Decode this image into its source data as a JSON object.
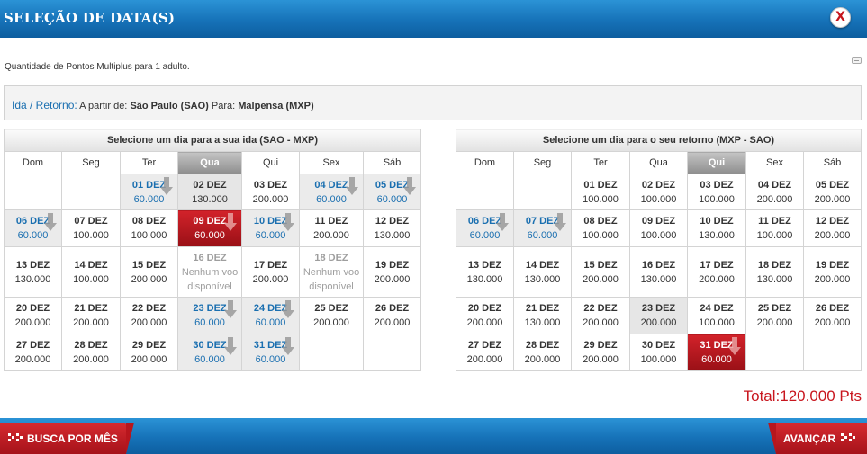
{
  "header": {
    "title": "SELEÇÃO DE DATA(S)",
    "close_label": "X"
  },
  "info": {
    "quantity_text": "Quantidade de Pontos Multiplus para 1 adulto."
  },
  "route": {
    "label": "Ida / Retorno:",
    "from_prefix": "A partir de:",
    "from": "São Paulo (SAO)",
    "to_prefix": "Para:",
    "to": "Malpensa (MXP)"
  },
  "weekdays": [
    "Dom",
    "Seg",
    "Ter",
    "Qua",
    "Qui",
    "Sex",
    "Sáb"
  ],
  "outbound": {
    "title": "Selecione um dia para a sua ida (SAO - MXP)",
    "active_weekday": 3,
    "weeks": [
      [
        null,
        null,
        {
          "day": "01 DEZ",
          "points": "60.000",
          "state": "low"
        },
        {
          "day": "02 DEZ",
          "points": "130.000",
          "state": "grey"
        },
        {
          "day": "03 DEZ",
          "points": "200.000"
        },
        {
          "day": "04 DEZ",
          "points": "60.000",
          "state": "low"
        },
        {
          "day": "05 DEZ",
          "points": "60.000",
          "state": "low"
        }
      ],
      [
        {
          "day": "06 DEZ",
          "points": "60.000",
          "state": "low"
        },
        {
          "day": "07 DEZ",
          "points": "100.000"
        },
        {
          "day": "08 DEZ",
          "points": "100.000"
        },
        {
          "day": "09 DEZ",
          "points": "60.000",
          "state": "selected"
        },
        {
          "day": "10 DEZ",
          "points": "60.000",
          "state": "low"
        },
        {
          "day": "11 DEZ",
          "points": "200.000"
        },
        {
          "day": "12 DEZ",
          "points": "130.000"
        }
      ],
      [
        {
          "day": "13 DEZ",
          "points": "130.000"
        },
        {
          "day": "14 DEZ",
          "points": "100.000"
        },
        {
          "day": "15 DEZ",
          "points": "200.000"
        },
        {
          "day": "16 DEZ",
          "points": "Nenhum voo",
          "extra": "disponível",
          "state": "unavailable"
        },
        {
          "day": "17 DEZ",
          "points": "200.000"
        },
        {
          "day": "18 DEZ",
          "points": "Nenhum voo",
          "extra": "disponível",
          "state": "unavailable"
        },
        {
          "day": "19 DEZ",
          "points": "200.000"
        }
      ],
      [
        {
          "day": "20 DEZ",
          "points": "200.000"
        },
        {
          "day": "21 DEZ",
          "points": "200.000"
        },
        {
          "day": "22 DEZ",
          "points": "200.000"
        },
        {
          "day": "23 DEZ",
          "points": "60.000",
          "state": "low"
        },
        {
          "day": "24 DEZ",
          "points": "60.000",
          "state": "low"
        },
        {
          "day": "25 DEZ",
          "points": "200.000"
        },
        {
          "day": "26 DEZ",
          "points": "200.000"
        }
      ],
      [
        {
          "day": "27 DEZ",
          "points": "200.000"
        },
        {
          "day": "28 DEZ",
          "points": "200.000"
        },
        {
          "day": "29 DEZ",
          "points": "200.000"
        },
        {
          "day": "30 DEZ",
          "points": "60.000",
          "state": "low"
        },
        {
          "day": "31 DEZ",
          "points": "60.000",
          "state": "low"
        },
        null,
        null
      ]
    ]
  },
  "inbound": {
    "title": "Selecione um dia para o seu retorno (MXP - SAO)",
    "active_weekday": 4,
    "weeks": [
      [
        null,
        null,
        {
          "day": "01 DEZ",
          "points": "100.000"
        },
        {
          "day": "02 DEZ",
          "points": "100.000"
        },
        {
          "day": "03 DEZ",
          "points": "100.000"
        },
        {
          "day": "04 DEZ",
          "points": "200.000"
        },
        {
          "day": "05 DEZ",
          "points": "200.000"
        }
      ],
      [
        {
          "day": "06 DEZ",
          "points": "60.000",
          "state": "low"
        },
        {
          "day": "07 DEZ",
          "points": "60.000",
          "state": "low"
        },
        {
          "day": "08 DEZ",
          "points": "100.000"
        },
        {
          "day": "09 DEZ",
          "points": "100.000"
        },
        {
          "day": "10 DEZ",
          "points": "130.000"
        },
        {
          "day": "11 DEZ",
          "points": "100.000"
        },
        {
          "day": "12 DEZ",
          "points": "200.000"
        }
      ],
      [
        {
          "day": "13 DEZ",
          "points": "130.000"
        },
        {
          "day": "14 DEZ",
          "points": "130.000"
        },
        {
          "day": "15 DEZ",
          "points": "200.000"
        },
        {
          "day": "16 DEZ",
          "points": "130.000"
        },
        {
          "day": "17 DEZ",
          "points": "200.000"
        },
        {
          "day": "18 DEZ",
          "points": "130.000"
        },
        {
          "day": "19 DEZ",
          "points": "200.000"
        }
      ],
      [
        {
          "day": "20 DEZ",
          "points": "200.000"
        },
        {
          "day": "21 DEZ",
          "points": "130.000"
        },
        {
          "day": "22 DEZ",
          "points": "200.000"
        },
        {
          "day": "23 DEZ",
          "points": "200.000",
          "state": "grey"
        },
        {
          "day": "24 DEZ",
          "points": "100.000"
        },
        {
          "day": "25 DEZ",
          "points": "200.000"
        },
        {
          "day": "26 DEZ",
          "points": "200.000"
        }
      ],
      [
        {
          "day": "27 DEZ",
          "points": "200.000"
        },
        {
          "day": "28 DEZ",
          "points": "200.000"
        },
        {
          "day": "29 DEZ",
          "points": "200.000"
        },
        {
          "day": "30 DEZ",
          "points": "100.000"
        },
        {
          "day": "31 DEZ",
          "points": "60.000",
          "state": "selected"
        },
        null,
        null
      ]
    ]
  },
  "total": "Total:120.000 Pts",
  "footer": {
    "month_search_label": "BUSCA POR MÊS",
    "next_label": "AVANÇAR"
  },
  "colors": {
    "accent_blue": "#1672b8",
    "selected_red": "#c5161d",
    "low_price_blue": "#1a6fb0"
  },
  "icons": {
    "close": "close-icon",
    "low_price_marker": "down-arrow-icon",
    "button_marker": "dots-icon"
  }
}
